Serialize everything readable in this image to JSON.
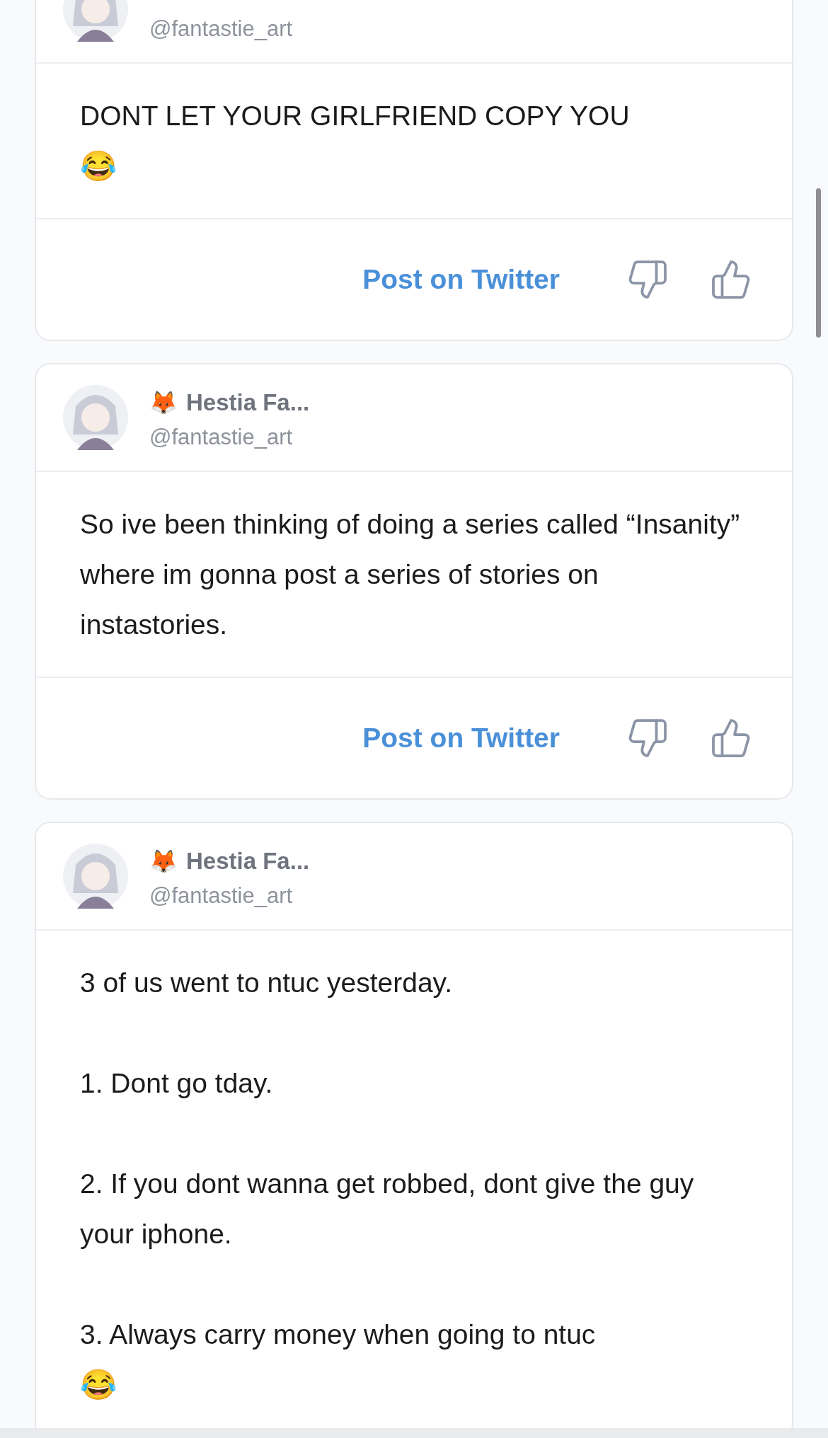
{
  "posts": [
    {
      "author": {
        "handle": "@fantastie_art"
      },
      "paragraphs": [
        {
          "text": "DONT LET YOUR GIRLFRIEND COPY YOU",
          "emoji": "😂"
        }
      ],
      "share_link": "Post on Twitter"
    },
    {
      "author": {
        "badge": "🦊",
        "name": "Hestia Fa...",
        "handle": "@fantastie_art"
      },
      "paragraphs": [
        {
          "text": "So ive been thinking of doing a series called “Insanity” where im gonna post a series of stories on instastories."
        }
      ],
      "share_link": "Post on Twitter"
    },
    {
      "author": {
        "badge": "🦊",
        "name": "Hestia Fa...",
        "handle": "@fantastie_art"
      },
      "paragraphs": [
        {
          "text": "3 of us went to ntuc yesterday."
        },
        {
          "text": "1. Dont go tday."
        },
        {
          "text": "2. If you dont wanna get robbed, dont give the guy your iphone."
        },
        {
          "text": "3. Always carry money when going to ntuc",
          "emoji": "😂"
        }
      ]
    }
  ]
}
